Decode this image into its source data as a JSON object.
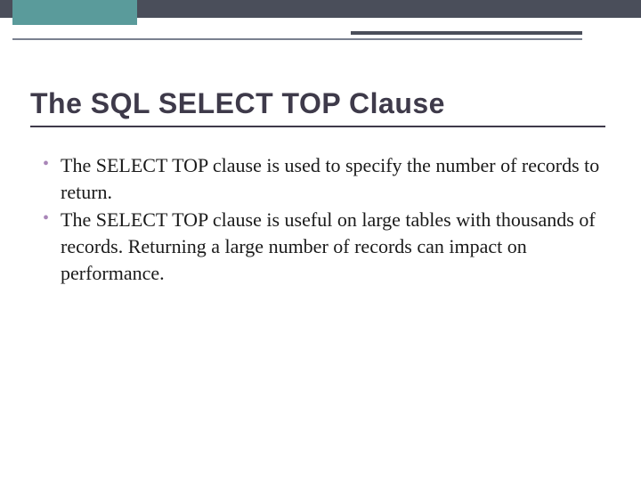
{
  "slide": {
    "title": "The SQL SELECT TOP Clause",
    "bullets": [
      "The SELECT TOP clause is used to specify the number of records to return.",
      "The SELECT TOP clause is useful on large tables with thousands of records. Returning a large number of records can impact on performance."
    ]
  }
}
